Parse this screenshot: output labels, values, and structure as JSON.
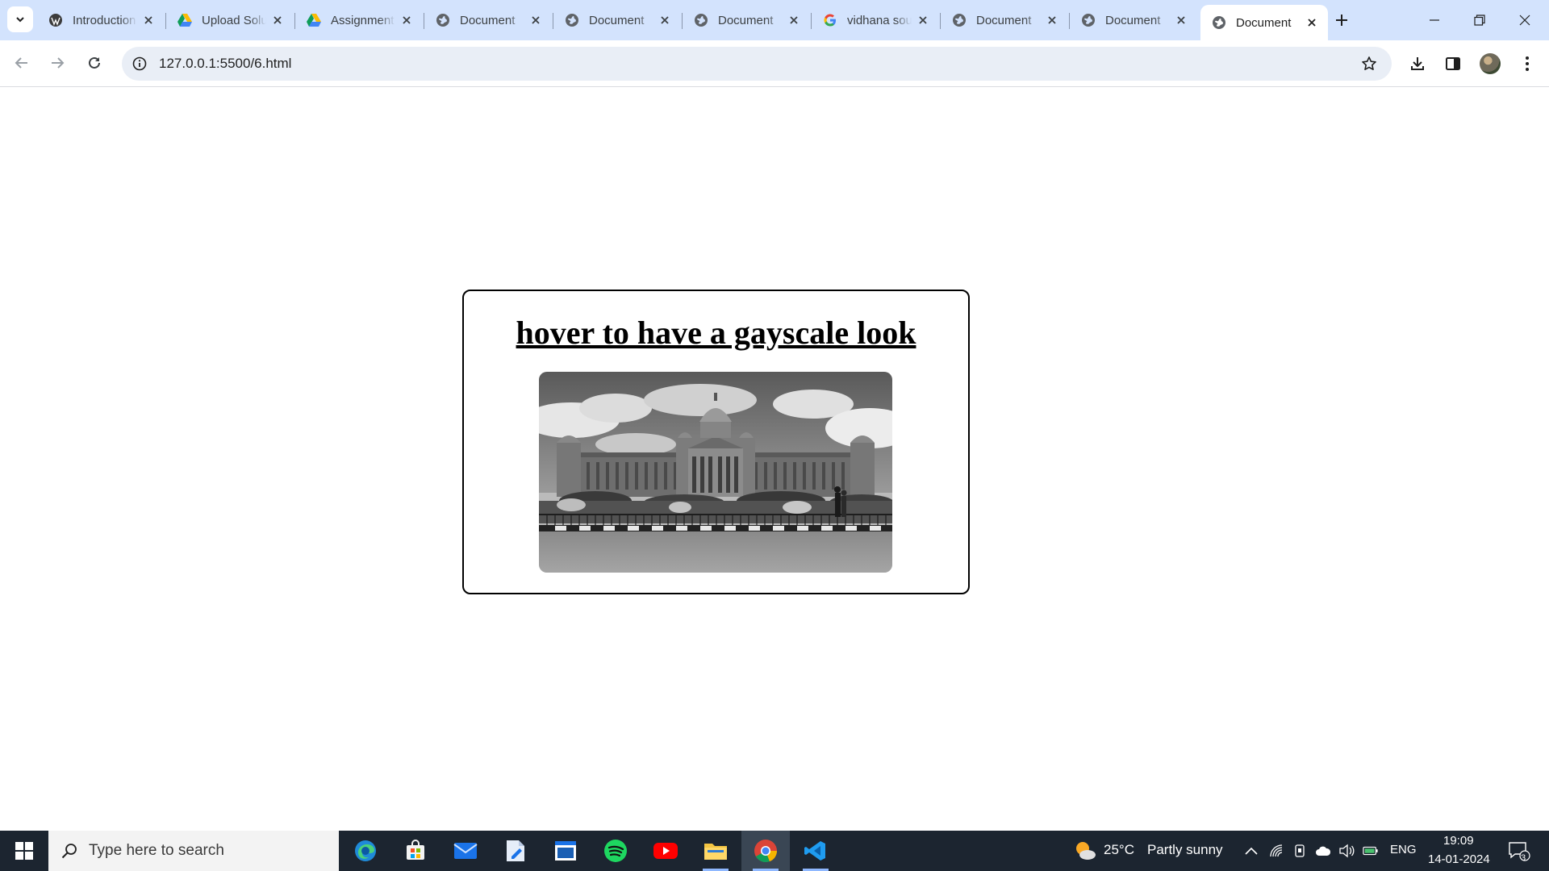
{
  "browser": {
    "tabs": [
      {
        "title": "Introduction",
        "favicon": "wordpress-icon",
        "active": false
      },
      {
        "title": "Upload Solution",
        "favicon": "google-drive-icon",
        "active": false
      },
      {
        "title": "Assignment",
        "favicon": "google-drive-icon",
        "active": false
      },
      {
        "title": "Document",
        "favicon": "globe-icon",
        "active": false
      },
      {
        "title": "Document",
        "favicon": "globe-icon",
        "active": false
      },
      {
        "title": "Document",
        "favicon": "globe-icon",
        "active": false
      },
      {
        "title": "vidhana soudha",
        "favicon": "google-icon",
        "active": false
      },
      {
        "title": "Document",
        "favicon": "globe-icon",
        "active": false
      },
      {
        "title": "Document",
        "favicon": "globe-icon",
        "active": false
      },
      {
        "title": "Document",
        "favicon": "globe-icon",
        "active": true
      }
    ],
    "address": {
      "url": "127.0.0.1:5500/6.html"
    }
  },
  "page": {
    "heading": "hover to have a gayscale look",
    "image": {
      "alt": "vidhana soudha",
      "filter": "grayscale"
    }
  },
  "taskbar": {
    "search_placeholder": "Type here to search",
    "apps": [
      "edge-icon",
      "store-icon",
      "mail-icon",
      "file-editor-icon",
      "notes-icon",
      "spotify-icon",
      "youtube-icon",
      "file-explorer-icon",
      "chrome-icon",
      "vscode-icon"
    ],
    "weather": {
      "temp": "25°C",
      "condition": "Partly sunny"
    },
    "language": "ENG",
    "time": "19:09",
    "date": "14-01-2024",
    "notifications": "3"
  },
  "colors": {
    "tabstrip": "#d3e3fd",
    "omnibox": "#e9eef6",
    "taskbar": "#1c2530",
    "card_border": "#000000"
  }
}
